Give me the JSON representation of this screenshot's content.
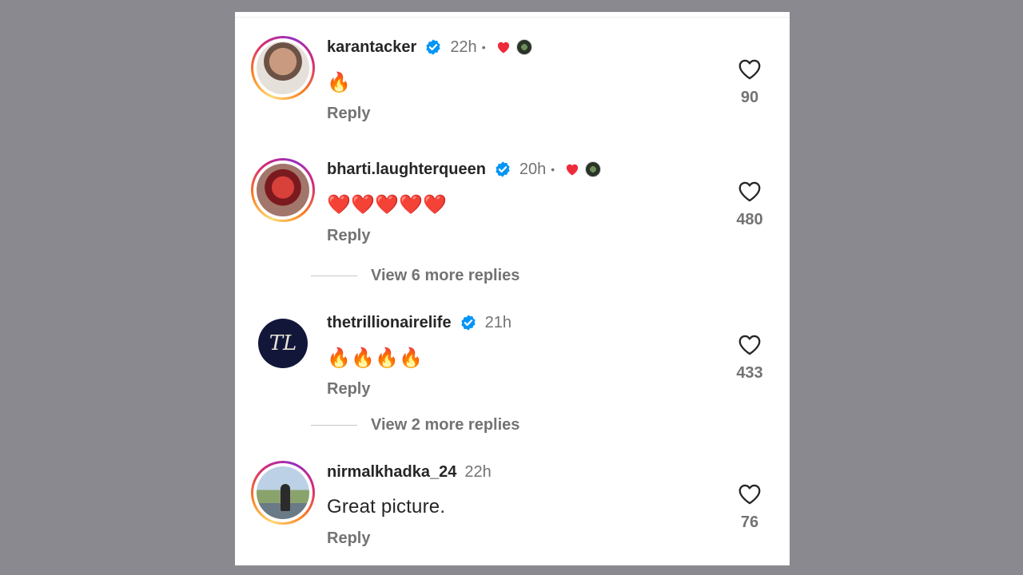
{
  "colors": {
    "heart_red": "#ed2b3a",
    "verified_blue": "#0095f6",
    "secondary_text": "#737373",
    "primary_text": "#262626"
  },
  "comments": [
    {
      "username": "karantacker",
      "verified": true,
      "time": "22h",
      "liked_by_author": true,
      "text": "🔥",
      "reply_label": "Reply",
      "like_count": "90",
      "avatar": "karantacker-avatar"
    },
    {
      "username": "bharti.laughterqueen",
      "verified": true,
      "time": "20h",
      "liked_by_author": true,
      "text": "❤️❤️❤️❤️❤️",
      "reply_label": "Reply",
      "like_count": "480",
      "avatar": "bharti-avatar"
    },
    {
      "username": "thetrillionairelife",
      "verified": true,
      "time": "21h",
      "liked_by_author": false,
      "text": "🔥🔥🔥🔥",
      "reply_label": "Reply",
      "like_count": "433",
      "avatar_monogram": "TL"
    },
    {
      "username": "nirmalkhadka_24",
      "verified": false,
      "time": "22h",
      "liked_by_author": false,
      "text": "Great picture.",
      "reply_label": "Reply",
      "like_count": "76",
      "avatar": "nirmalkhadka-avatar"
    }
  ],
  "view_more": [
    {
      "label": "View 6 more replies"
    },
    {
      "label": "View 2 more replies"
    }
  ],
  "icons": {
    "verified": "verified-badge-icon",
    "like": "heart-outline-icon",
    "author_like": "heart-filled-icon"
  }
}
